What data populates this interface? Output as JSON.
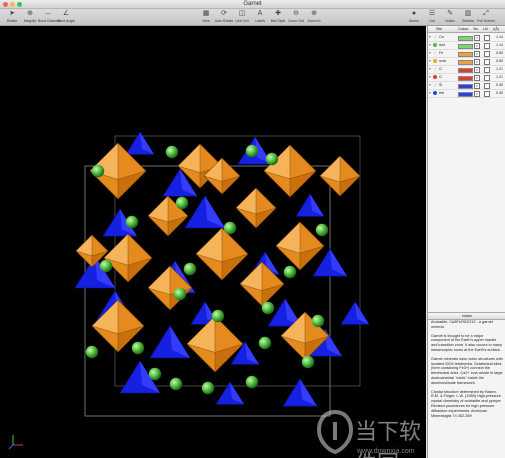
{
  "window": {
    "title": "Garnet",
    "traffic_colors": [
      "#fc605c",
      "#fdbc40",
      "#34c84a"
    ]
  },
  "toolbar": {
    "left": [
      {
        "icon": "select-arrow-icon",
        "glyph": "➤",
        "label": "Rotate"
      },
      {
        "icon": "zoom-icon",
        "glyph": "⊕",
        "label": "Magnify"
      },
      {
        "icon": "bond-distance-icon",
        "glyph": "↔",
        "label": "Bond Distance"
      },
      {
        "icon": "bond-angle-icon",
        "glyph": "∠",
        "label": "Bond Angle"
      }
    ],
    "center": [
      {
        "icon": "view-icon",
        "glyph": "▦",
        "label": "View"
      },
      {
        "icon": "auto-rotate-icon",
        "glyph": "⟳",
        "label": "Auto Rotate"
      },
      {
        "icon": "unit-cell-icon",
        "glyph": "◫",
        "label": "Unit Cell"
      },
      {
        "icon": "labels-icon",
        "glyph": "A",
        "label": "Labels"
      },
      {
        "icon": "ball-style-icon",
        "glyph": "✚",
        "label": "Ball Style"
      },
      {
        "icon": "zoom-out-icon",
        "glyph": "⊖",
        "label": "Zoom Out"
      },
      {
        "icon": "zoom-in-icon",
        "glyph": "⊕",
        "label": "Zoom In"
      }
    ],
    "right": [
      {
        "icon": "atoms-icon",
        "glyph": "●",
        "label": "Atoms"
      },
      {
        "icon": "lists-icon",
        "glyph": "☰",
        "label": "List"
      },
      {
        "icon": "notes-icon",
        "glyph": "✎",
        "label": "Notes"
      },
      {
        "icon": "sidebar-icon",
        "glyph": "▥",
        "label": "Sidebar"
      },
      {
        "icon": "full-screen-icon",
        "glyph": "⤢",
        "label": "Full Screen"
      }
    ]
  },
  "atom_table": {
    "columns": [
      "Site",
      "Colour",
      "Vis",
      "Lbl",
      "r(Å)"
    ],
    "rows": [
      {
        "name": "Ca",
        "dot": "#e8e8e8",
        "swatch": "#7ad66b",
        "radius": "1.14"
      },
      {
        "name": "dod",
        "dot": "#58b848",
        "swatch": "#7ad66b",
        "radius": "1.14"
      },
      {
        "name": "Fe",
        "dot": "#e8e8e8",
        "swatch": "#f3a03a",
        "radius": "0.69"
      },
      {
        "name": "octa",
        "dot": "#f3a03a",
        "swatch": "#f3a03a",
        "radius": "0.69"
      },
      {
        "name": "O",
        "dot": "#e8e8e8",
        "swatch": "#e33b2e",
        "radius": "1.21"
      },
      {
        "name": "O",
        "dot": "#e33b2e",
        "swatch": "#e33b2e",
        "radius": "1.21"
      },
      {
        "name": "Si",
        "dot": "#e8e8e8",
        "swatch": "#2d3ee8",
        "radius": "0.40"
      },
      {
        "name": "tetr",
        "dot": "#2d3ee8",
        "swatch": "#2d3ee8",
        "radius": "0.40"
      }
    ]
  },
  "notes": {
    "header": "Notes",
    "paragraphs": [
      "Andradite, Ca3Fe2Si3O12 - a garnet mineral.",
      "Garnet is thought to be a major component of the Earth's upper mantle and transition zone. It also occurs in many metamorphic rocks at the Earth's surface.",
      "Garnet minerals have cubic structures with isolated SiO4 tetrahedra. Octahedral sites (here containing Fe3+) connect the tetrahedral ones. Ca2+ ions reside in large dodecahedral \"voids\" inside the aluminosilicate framework.",
      "Crystal structure determined by Hazen, R.M. & Finger, L.W. (1989) High-pressure crystal chemistry of andradite and pyrope: Revised procedures for high-pressure diffraction experiments. American Mineralogist 74 352-359"
    ]
  },
  "watermark": {
    "title": "当下软件园",
    "url": "www.downxia.com"
  }
}
